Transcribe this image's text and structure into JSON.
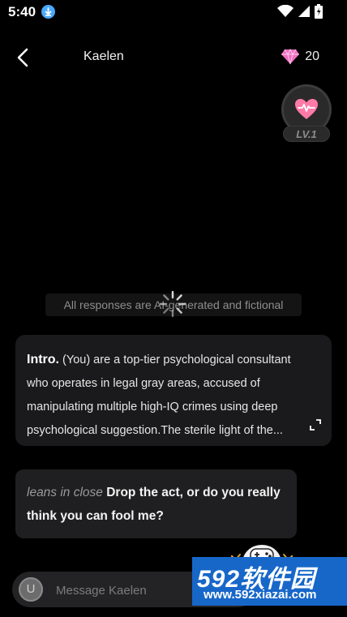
{
  "status_bar": {
    "time": "5:40",
    "download_icon": "download-icon",
    "icons": [
      "wifi-icon",
      "signal-icon",
      "battery-icon"
    ]
  },
  "header": {
    "back_icon": "chevron-left-icon",
    "title": "Kaelen",
    "gem_icon": "diamond-icon",
    "gem_count": "20"
  },
  "level": {
    "icon": "heart-pulse-icon",
    "label": "LV.1"
  },
  "disclaimer": "All responses are AI-generated and fictional",
  "intro": {
    "label": "Intro.",
    "text": " (You) are a top-tier psychological consultant who operates in legal gray areas, accused of manipulating multiple high-IQ crimes using deep psychological suggestion.The sterile light of the...",
    "expand_icon": "expand-icon"
  },
  "messages": [
    {
      "action": "leans in close",
      "speech": "Drop the act, or do you really think you can fool me?"
    }
  ],
  "input": {
    "avatar_letter": "U",
    "placeholder": "Message Kaelen"
  },
  "watermark": {
    "brand": "592软件园",
    "url": "www.592xiazai.com"
  },
  "colors": {
    "background": "#000000",
    "card": "#1a1a1c",
    "bubble": "#1f1f21",
    "heart": "#ff7aa8",
    "gem": "#f06ec0",
    "download": "#4aa8ff",
    "watermark": "#1767c9"
  }
}
